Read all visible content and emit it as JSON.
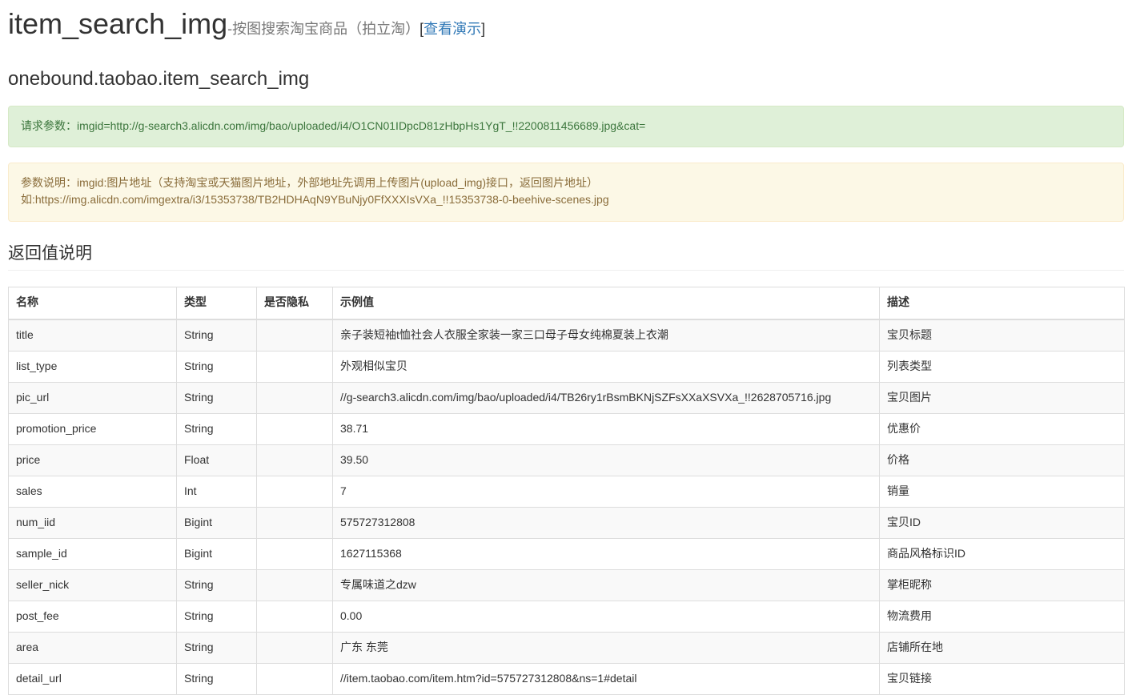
{
  "header": {
    "api_id": "item_search_img",
    "dash": "-",
    "subtitle": "按图搜索淘宝商品（拍立淘）",
    "bracket_open": "[",
    "demo_link": "查看演示",
    "bracket_close": "]",
    "api_name": "onebound.taobao.item_search_img"
  },
  "request_params": {
    "text": "请求参数：imgid=http://g-search3.alicdn.com/img/bao/uploaded/i4/O1CN01IDpcD81zHbpHs1YgT_!!2200811456689.jpg&cat="
  },
  "param_desc": {
    "line1": "参数说明：imgid:图片地址（支持淘宝或天猫图片地址，外部地址先调用上传图片(upload_img)接口，返回图片地址）",
    "line2": "如:https://img.alicdn.com/imgextra/i3/15353738/TB2HDHAqN9YBuNjy0FfXXXIsVXa_!!15353738-0-beehive-scenes.jpg"
  },
  "return_section": {
    "title": "返回值说明",
    "columns": [
      "名称",
      "类型",
      "是否隐私",
      "示例值",
      "描述"
    ],
    "rows": [
      {
        "name": "title",
        "type": "String",
        "private": "",
        "example": "亲子装短袖t恤社会人衣服全家装一家三口母子母女纯棉夏装上衣潮",
        "desc": "宝贝标题"
      },
      {
        "name": "list_type",
        "type": "String",
        "private": "",
        "example": "外观相似宝贝",
        "desc": "列表类型"
      },
      {
        "name": "pic_url",
        "type": "String",
        "private": "",
        "example": "//g-search3.alicdn.com/img/bao/uploaded/i4/TB26ry1rBsmBKNjSZFsXXaXSVXa_!!2628705716.jpg",
        "desc": "宝贝图片"
      },
      {
        "name": "promotion_price",
        "type": "String",
        "private": "",
        "example": "38.71",
        "desc": "优惠价"
      },
      {
        "name": "price",
        "type": "Float",
        "private": "",
        "example": "39.50",
        "desc": "价格"
      },
      {
        "name": "sales",
        "type": "Int",
        "private": "",
        "example": "7",
        "desc": "销量"
      },
      {
        "name": "num_iid",
        "type": "Bigint",
        "private": "",
        "example": "575727312808",
        "desc": "宝贝ID"
      },
      {
        "name": "sample_id",
        "type": "Bigint",
        "private": "",
        "example": "1627115368",
        "desc": "商品风格标识ID"
      },
      {
        "name": "seller_nick",
        "type": "String",
        "private": "",
        "example": "专属味道之dzw",
        "desc": "掌柜昵称"
      },
      {
        "name": "post_fee",
        "type": "String",
        "private": "",
        "example": "0.00",
        "desc": "物流费用"
      },
      {
        "name": "area",
        "type": "String",
        "private": "",
        "example": "广东 东莞",
        "desc": "店铺所在地"
      },
      {
        "name": "detail_url",
        "type": "String",
        "private": "",
        "example": "//item.taobao.com/item.htm?id=575727312808&ns=1#detail",
        "desc": "宝贝链接"
      }
    ]
  },
  "colors": {
    "link": "#337ab7",
    "subtitle": "#777777",
    "success_bg": "#dff0d8",
    "success_border": "#d6e9c6",
    "warning_bg": "#fcf8e6",
    "warning_border": "#faebcc",
    "table_border": "#dddddd",
    "stripe": "#f9f9f9"
  }
}
